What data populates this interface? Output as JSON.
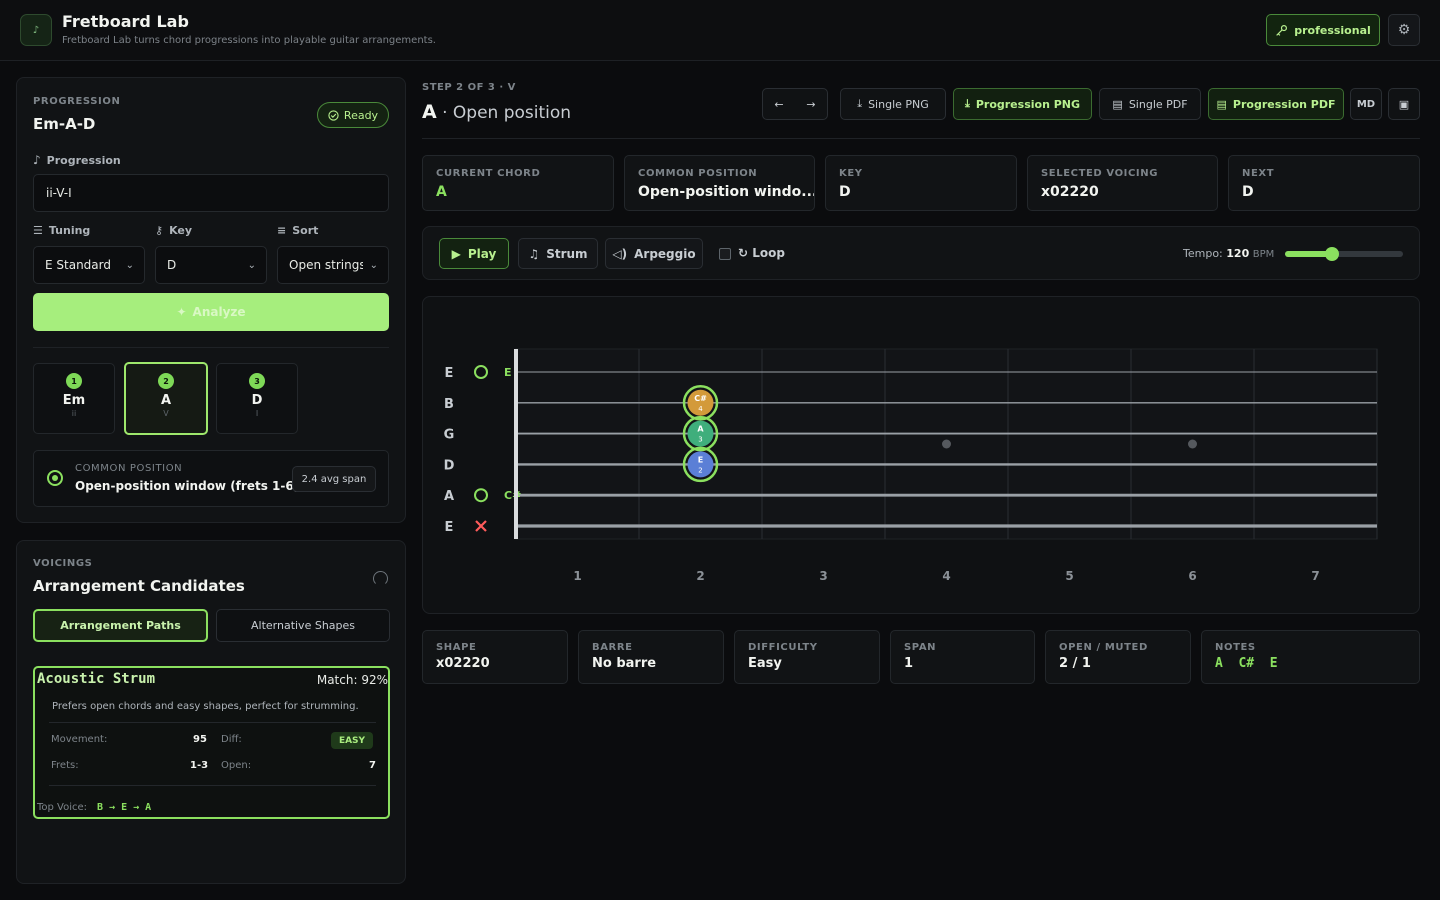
{
  "header": {
    "title": "Fretboard Lab",
    "subtitle": "Fretboard Lab turns chord progressions into playable guitar arrangements.",
    "pro_label": "professional"
  },
  "progression_panel": {
    "kicker": "PROGRESSION",
    "title": "Em-A-D",
    "status": "Ready",
    "progression_label": "Progression",
    "progression_value": "ii-V-I",
    "tuning_label": "Tuning",
    "tuning_value": "E Standard",
    "key_label": "Key",
    "key_value": "D",
    "sort_label": "Sort",
    "sort_value": "Open strings",
    "analyze_label": "Analyze",
    "chords": [
      {
        "num": "1",
        "name": "Em",
        "degree": "ii"
      },
      {
        "num": "2",
        "name": "A",
        "degree": "V"
      },
      {
        "num": "3",
        "name": "D",
        "degree": "I"
      }
    ],
    "common_kicker": "COMMON POSITION",
    "common_value": "Open-position window (frets 1-6)",
    "avg_span": "2.4 avg span"
  },
  "voicings_panel": {
    "kicker": "VOICINGS",
    "title": "Arrangement Candidates",
    "tabs": [
      "Arrangement Paths",
      "Alternative Shapes"
    ],
    "card": {
      "name": "Acoustic Strum",
      "match": "Match: 92%",
      "desc": "Prefers open chords and easy shapes, perfect for strumming.",
      "movement_label": "Movement:",
      "movement": "95",
      "diff_label": "Diff:",
      "diff": "EASY",
      "frets_label": "Frets:",
      "frets": "1-3",
      "open_label": "Open:",
      "open": "7",
      "top_voice_label": "Top Voice:",
      "top_voice": "B → E → A"
    }
  },
  "main": {
    "step": "STEP 2 OF 3 · V",
    "chord": "A",
    "position": " · Open position",
    "buttons": {
      "single_png": "Single PNG",
      "progression_png": "Progression PNG",
      "single_pdf": "Single PDF",
      "progression_pdf": "Progression PDF",
      "md": "MD"
    },
    "stats": [
      {
        "label": "CURRENT CHORD",
        "value": "A",
        "green": true
      },
      {
        "label": "COMMON POSITION",
        "value": "Open-position windo...",
        "green": false
      },
      {
        "label": "KEY",
        "value": "D",
        "green": false
      },
      {
        "label": "SELECTED VOICING",
        "value": "x02220",
        "green": false
      },
      {
        "label": "NEXT",
        "value": "D",
        "green": false
      }
    ],
    "player": {
      "play": "Play",
      "strum": "Strum",
      "arpeggio": "Arpeggio",
      "loop": "Loop",
      "tempo_label": "Tempo:",
      "tempo": "120",
      "tempo_unit": "BPM",
      "tempo_fraction": 0.4
    },
    "details": [
      {
        "label": "SHAPE",
        "value": "x02220"
      },
      {
        "label": "BARRE",
        "value": "No barre"
      },
      {
        "label": "DIFFICULTY",
        "value": "Easy"
      },
      {
        "label": "SPAN",
        "value": "1"
      },
      {
        "label": "OPEN / MUTED",
        "value": "2 / 1"
      },
      {
        "label": "NOTES",
        "value": "A  C#  E",
        "green": true
      }
    ]
  },
  "fretboard": {
    "strings": [
      "E",
      "B",
      "G",
      "D",
      "A",
      "E"
    ],
    "string_status": [
      "open",
      "",
      "",
      "",
      "open",
      "muted"
    ],
    "open_notes": [
      "E",
      "",
      "",
      "",
      "C#",
      ""
    ],
    "fret_numbers": [
      "1",
      "2",
      "3",
      "4",
      "5",
      "6",
      "7"
    ],
    "markers": [
      4,
      6
    ],
    "notes": [
      {
        "string": 1,
        "fret": 2,
        "note": "C#",
        "finger": "4",
        "color": "#d39a3a"
      },
      {
        "string": 2,
        "fret": 2,
        "note": "A",
        "finger": "3",
        "color": "#3fae7c"
      },
      {
        "string": 3,
        "fret": 2,
        "note": "E",
        "finger": "2",
        "color": "#5b7fd6"
      }
    ]
  }
}
